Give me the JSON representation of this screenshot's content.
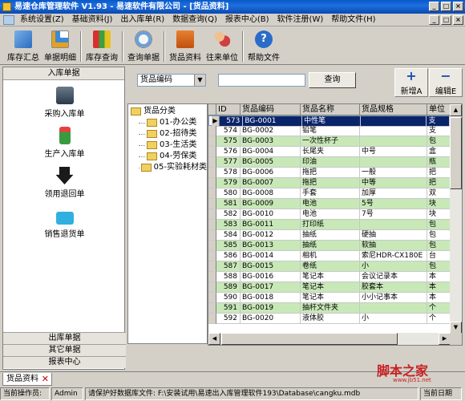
{
  "window": {
    "title": "易速仓库管理软件 V1.93 - 易速软件有限公司 - [货品资料]"
  },
  "menu": [
    "系统设置(Z)",
    "基础资料(J)",
    "出入库单(R)",
    "数据查询(Q)",
    "报表中心(B)",
    "软件注册(W)",
    "帮助文件(H)"
  ],
  "toolbar": [
    {
      "label": "库存汇总",
      "icon": "inventory-summary-icon"
    },
    {
      "label": "单据明细",
      "icon": "document-detail-icon"
    },
    {
      "label": "库存查询",
      "icon": "stock-query-icon"
    },
    {
      "label": "查询单据",
      "icon": "search-document-icon"
    },
    {
      "label": "货品资料",
      "icon": "goods-data-icon"
    },
    {
      "label": "往来单位",
      "icon": "partners-icon"
    },
    {
      "label": "帮助文件",
      "icon": "help-icon"
    }
  ],
  "sidebar": {
    "header": "入库单据",
    "items": [
      {
        "label": "采购入库单",
        "icon": "truck-icon"
      },
      {
        "label": "生产入库单",
        "icon": "production-icon"
      },
      {
        "label": "领用退回单",
        "icon": "return-icon"
      },
      {
        "label": "销售退货单",
        "icon": "sales-return-icon"
      }
    ],
    "footers": [
      "出库单据",
      "其它单据",
      "报表中心"
    ]
  },
  "filter": {
    "field_select": "货品编码",
    "search_value": "",
    "query_label": "查询"
  },
  "actions": {
    "add_label": "新增A",
    "edit_label": "编辑E",
    "add_glyph": "+",
    "edit_glyph": "−"
  },
  "tree": {
    "root": "货品分类",
    "children": [
      "01-办公类",
      "02-招待类",
      "03-生活类",
      "04-劳保类",
      "05-实验耗材类"
    ]
  },
  "table": {
    "columns": [
      "ID",
      "货品编码",
      "货品名称",
      "货品规格",
      "单位"
    ],
    "rows": [
      [
        "573",
        "BG-0001",
        "中性笔",
        "",
        "支"
      ],
      [
        "574",
        "BG-0002",
        "铅笔",
        "",
        "支"
      ],
      [
        "575",
        "BG-0003",
        "一次性杯子",
        "",
        "包"
      ],
      [
        "576",
        "BG-0004",
        "长尾夹",
        "中号",
        "盒"
      ],
      [
        "577",
        "BG-0005",
        "印油",
        "",
        "瓶"
      ],
      [
        "578",
        "BG-0006",
        "拖把",
        "一般",
        "把"
      ],
      [
        "579",
        "BG-0007",
        "拖把",
        "中等",
        "把"
      ],
      [
        "580",
        "BG-0008",
        "手套",
        "加厚",
        "双"
      ],
      [
        "581",
        "BG-0009",
        "电池",
        "5号",
        "块"
      ],
      [
        "582",
        "BG-0010",
        "电池",
        "7号",
        "块"
      ],
      [
        "583",
        "BG-0011",
        "打印纸",
        "",
        "包"
      ],
      [
        "584",
        "BG-0012",
        "抽纸",
        "硬抽",
        "包"
      ],
      [
        "585",
        "BG-0013",
        "抽纸",
        "软抽",
        "包"
      ],
      [
        "586",
        "BG-0014",
        "相机",
        "索尼HDR-CX180E",
        "台"
      ],
      [
        "587",
        "BG-0015",
        "卷纸",
        "小",
        "包"
      ],
      [
        "588",
        "BG-0016",
        "笔记本",
        "会议记录本",
        "本"
      ],
      [
        "589",
        "BG-0017",
        "笔记本",
        "胶套本",
        "本"
      ],
      [
        "590",
        "BG-0018",
        "笔记本",
        "小小记事本",
        "本"
      ],
      [
        "591",
        "BG-0019",
        "抽杆文件夹",
        "",
        "个"
      ],
      [
        "592",
        "BG-0020",
        "液体胶",
        "小",
        "个"
      ]
    ],
    "selected_row": 0
  },
  "tabs": [
    {
      "label": "货品资料"
    }
  ],
  "status": {
    "operator_label": "当前操作员:",
    "operator": "Admin",
    "message": "请保护好数据库文件: F:\\安装试用\\易速出入库管理软件193\\Database\\cangku.mdb",
    "date_label": "当前日期"
  },
  "watermark": {
    "text": "脚本之家",
    "sub": "www.jb51.net"
  }
}
